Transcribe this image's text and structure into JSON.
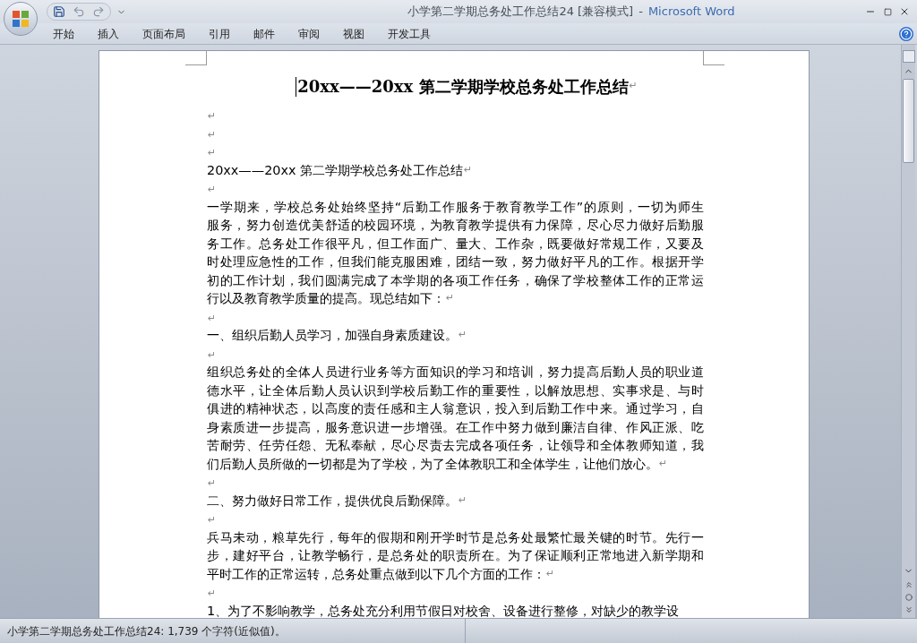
{
  "window": {
    "title": "小学第二学期总务处工作总结24 [兼容模式]",
    "separator": "-",
    "app_name": "Microsoft Word"
  },
  "ribbon_tabs": [
    {
      "label": "开始"
    },
    {
      "label": "插入"
    },
    {
      "label": "页面布局"
    },
    {
      "label": "引用"
    },
    {
      "label": "邮件"
    },
    {
      "label": "审阅"
    },
    {
      "label": "视图"
    },
    {
      "label": "开发工具"
    }
  ],
  "document": {
    "title": "20xx——20xx 第二学期学校总务处工作总结",
    "title_mark": "↵",
    "paragraphs": [
      {
        "kind": "blank",
        "mark": "↵"
      },
      {
        "kind": "blank",
        "mark": "↵"
      },
      {
        "kind": "blank",
        "mark": "↵"
      },
      {
        "kind": "text",
        "lines": [
          "20xx——20xx 第二学期学校总务处工作总结"
        ],
        "mark": "↵"
      },
      {
        "kind": "blank",
        "mark": "↵"
      },
      {
        "kind": "text",
        "lines": [
          "一学期来，学校总务处始终坚持“后勤工作服务于教育教学工作”的原则，一切为师生",
          "服务，努力创造优美舒适的校园环境，为教育教学提供有力保障，尽心尽力做好后勤服",
          "务工作。总务处工作很平凡，但工作面广、量大、工作杂，既要做好常规工作，又要及",
          "时处理应急性的工作，但我们能克服困难，团结一致，努力做好平凡的工作。根据开学",
          "初的工作计划，我们圆满完成了本学期的各项工作任务，确保了学校整体工作的正常运",
          "行以及教育教学质量的提高。现总结如下："
        ],
        "mark": "↵"
      },
      {
        "kind": "blank",
        "mark": "↵"
      },
      {
        "kind": "text",
        "lines": [
          "一、组织后勤人员学习，加强自身素质建设。"
        ],
        "mark": "↵"
      },
      {
        "kind": "blank",
        "mark": "↵"
      },
      {
        "kind": "text",
        "lines": [
          "组织总务处的全体人员进行业务等方面知识的学习和培训，努力提高后勤人员的职业道",
          "德水平，让全体后勤人员认识到学校后勤工作的重要性，以解放思想、实事求是、与时",
          "俱进的精神状态，以高度的责任感和主人翁意识，投入到后勤工作中来。通过学习，自",
          "身素质进一步提高，服务意识进一步增强。在工作中努力做到廉洁自律、作风正派、吃",
          "苦耐劳、任劳任怨、无私奉献，尽心尽责去完成各项任务，让领导和全体教师知道，我",
          "们后勤人员所做的一切都是为了学校，为了全体教职工和全体学生，让他们放心。"
        ],
        "mark": "↵"
      },
      {
        "kind": "blank",
        "mark": "↵"
      },
      {
        "kind": "text",
        "lines": [
          "二、努力做好日常工作，提供优良后勤保障。"
        ],
        "mark": "↵"
      },
      {
        "kind": "blank",
        "mark": "↵"
      },
      {
        "kind": "text",
        "lines": [
          "兵马未动，粮草先行，每年的假期和刚开学时节是总务处最繁忙最关键的时节。先行一",
          "步，建好平台，让教学畅行，是总务处的职责所在。为了保证顺利正常地进入新学期和",
          "平时工作的正常运转，总务处重点做到以下几个方面的工作："
        ],
        "mark": "↵"
      },
      {
        "kind": "blank",
        "mark": "↵"
      },
      {
        "kind": "text",
        "lines": [
          "1、为了不影响教学，总务处充分利用节假日对校舍、设备进行整修，对缺少的教学设"
        ]
      }
    ]
  },
  "status_bar": {
    "text": "小学第二学期总务处工作总结24: 1,739 个字符(近似值)。"
  }
}
